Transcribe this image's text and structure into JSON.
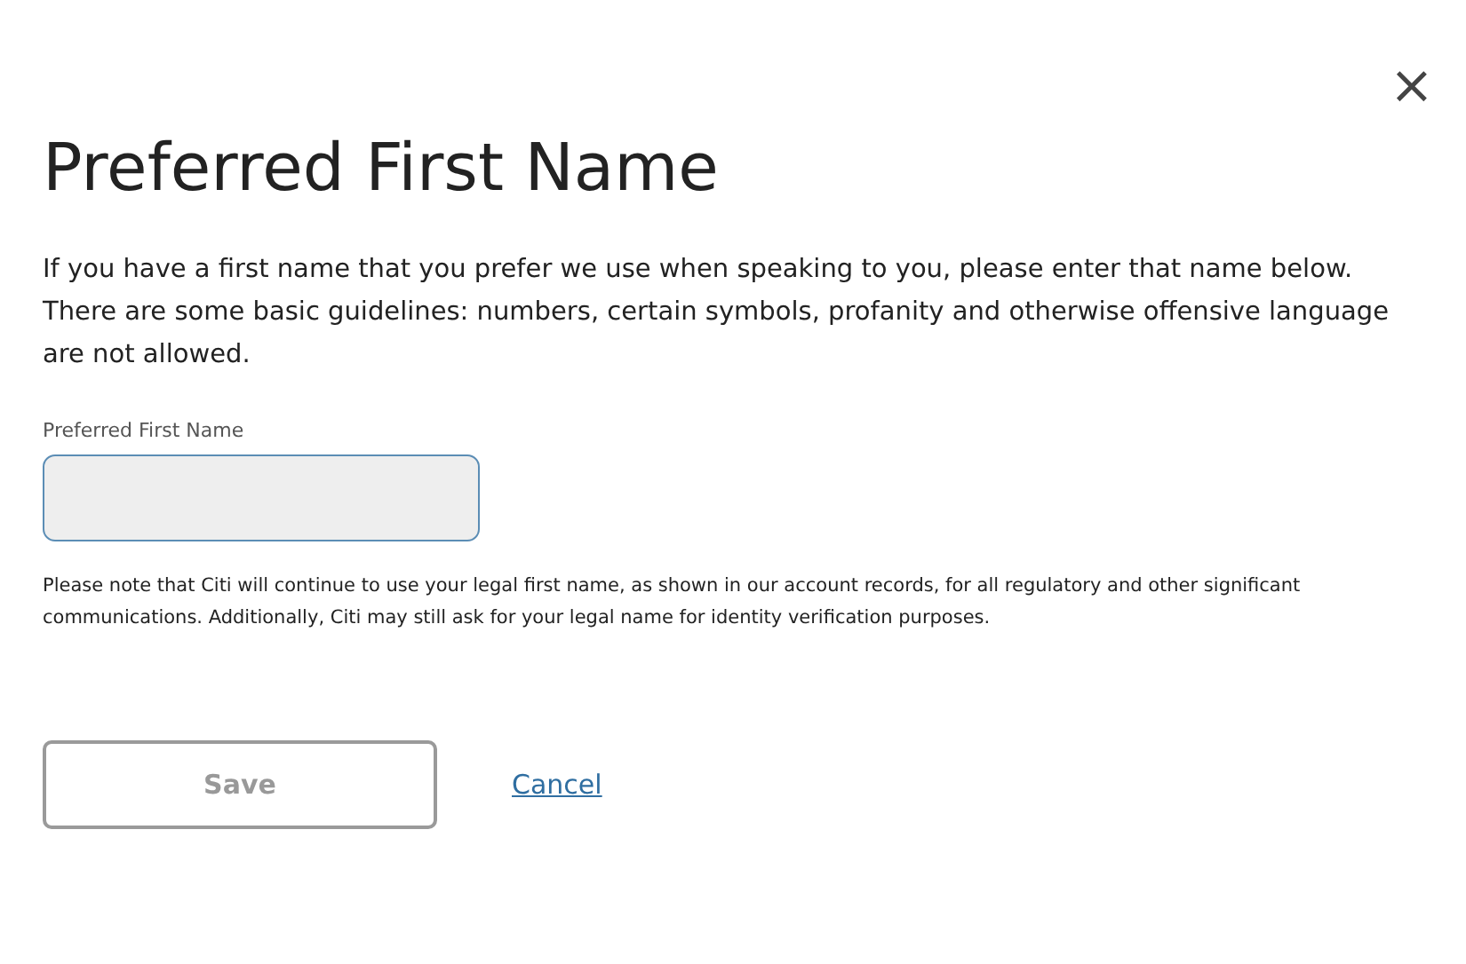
{
  "close_button": {
    "label": "×"
  },
  "title": "Preferred First Name",
  "intro": "If you have a first name that you prefer we use when speaking to you, please enter that name below. There are some basic guidelines: numbers, certain symbols, profanity and otherwise offensive language are not allowed.",
  "field": {
    "label": "Preferred First Name"
  },
  "note": "Please note that Citi will continue to use your legal first name, as shown in our account records, for all regulatory and other significant communications. Additionally, Citi may still ask for your legal name for identity verification purposes.",
  "save_button": {
    "label": "Save",
    "disabled": true
  },
  "cancel_link": {
    "label": "Cancel"
  }
}
